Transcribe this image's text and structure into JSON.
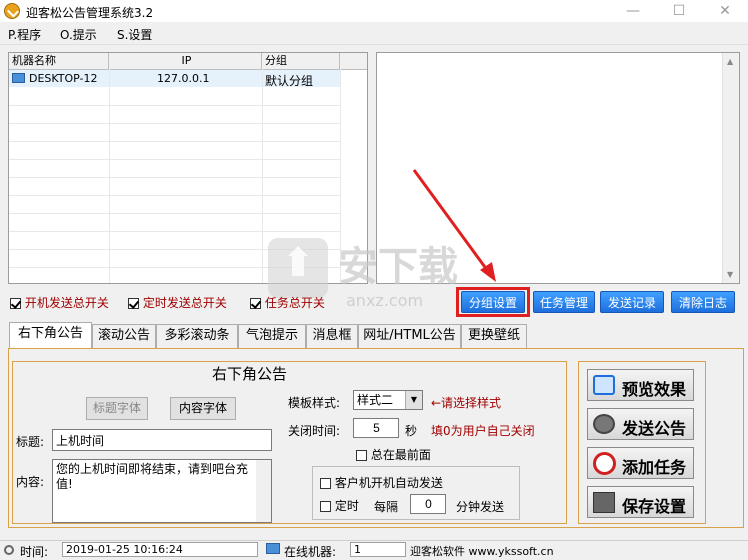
{
  "window": {
    "title": "迎客松公告管理系统3.2",
    "min": "—",
    "max": "☐",
    "close": "✕"
  },
  "menu": [
    {
      "label": "P.程序"
    },
    {
      "label": "O.提示"
    },
    {
      "label": "S.设置"
    }
  ],
  "table": {
    "headers": [
      "机器名称",
      "IP",
      "分组"
    ],
    "rows": [
      {
        "name": "DESKTOP-12",
        "ip": "127.0.0.1",
        "group": "默认分组"
      }
    ]
  },
  "switches": [
    {
      "label": "开机发送总开关",
      "checked": true
    },
    {
      "label": "定时发送总开关",
      "checked": true
    },
    {
      "label": "任务总开关",
      "checked": true
    }
  ],
  "action_buttons": [
    "分组设置",
    "任务管理",
    "发送记录",
    "清除日志"
  ],
  "tabs": [
    "右下角公告",
    "滚动公告",
    "多彩滚动条",
    "气泡提示",
    "消息框",
    "网址/HTML公告",
    "更换壁纸"
  ],
  "form": {
    "heading": "右下角公告",
    "title_font_btn": "标题字体",
    "content_font_btn": "内容字体",
    "title_label": "标题:",
    "title_value": "上机时间",
    "content_label": "内容:",
    "content_value": "您的上机时间即将结束，请到吧台充值!",
    "template_label": "模板样式:",
    "template_value": "样式二",
    "template_hint": "←请选择样式",
    "close_label": "关闭时间:",
    "close_value": "5",
    "close_unit": "秒",
    "close_hint": "填0为用户自己关闭",
    "topmost_label": "总在最前面",
    "auto_send_label": "客户机开机自动发送",
    "timed_label": "定时",
    "every_label": "每隔",
    "every_value": "0",
    "minutes_label": "分钟发送"
  },
  "side_buttons": [
    "预览效果",
    "发送公告",
    "添加任务",
    "保存设置"
  ],
  "status": {
    "time_label": "时间:",
    "time_value": "2019-01-25 10:16:24",
    "online_label": "在线机器:",
    "online_value": "1",
    "company": "迎客松软件 www.ykssoft.cn"
  },
  "watermark": {
    "text": "安下载",
    "sub": "anxz.com"
  },
  "colors": {
    "accent_border": "#d9a24a",
    "blue_button": "#1e6fdc",
    "highlight_red": "#e02020",
    "hint_red": "#a00000"
  }
}
